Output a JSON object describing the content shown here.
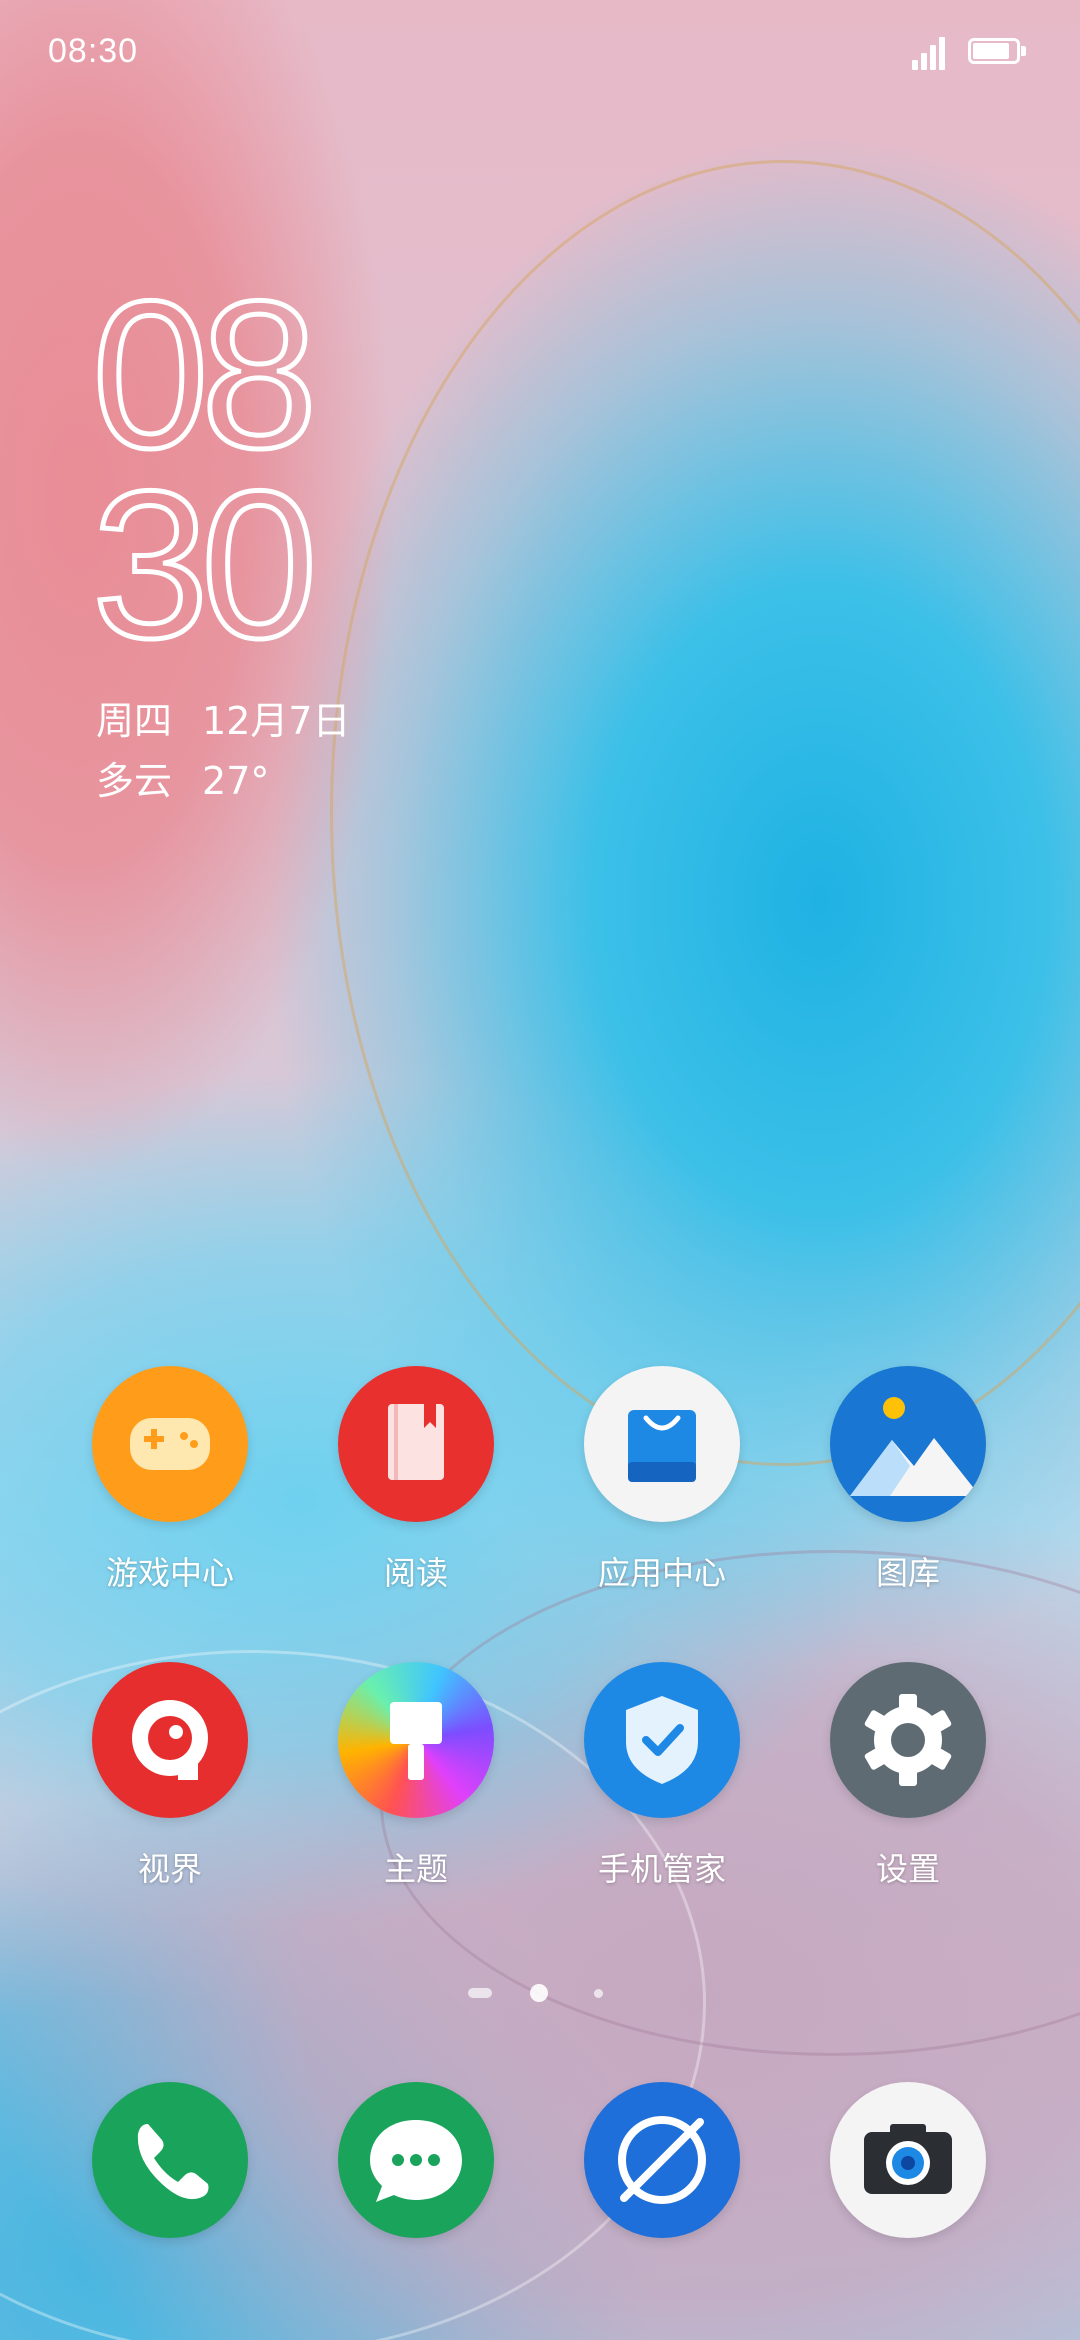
{
  "status_bar": {
    "time": "08:30",
    "battery_level": 0.85,
    "signal_bars": 4
  },
  "clock_widget": {
    "hour": "08",
    "minute": "30",
    "weekday": "周四",
    "date": "12月7日",
    "weather": "多云",
    "temperature": "27°"
  },
  "apps": [
    {
      "label": "游戏中心",
      "icon": "gamepad-icon",
      "color": "#ff9c1a"
    },
    {
      "label": "阅读",
      "icon": "book-icon",
      "color": "#e8312f"
    },
    {
      "label": "应用中心",
      "icon": "shopping-bag-icon",
      "color": "#1e88e5"
    },
    {
      "label": "图库",
      "icon": "gallery-icon",
      "color": "#1976d2"
    },
    {
      "label": "视界",
      "icon": "video-eye-icon",
      "color": "#e62e2e"
    },
    {
      "label": "主题",
      "icon": "paintbrush-icon",
      "color": "#e040fb"
    },
    {
      "label": "手机管家",
      "icon": "shield-check-icon",
      "color": "#1e88e5"
    },
    {
      "label": "设置",
      "icon": "gear-icon",
      "color": "#5f6b73"
    }
  ],
  "dock": [
    {
      "icon": "phone-icon",
      "color": "#1aa35a"
    },
    {
      "icon": "message-icon",
      "color": "#1aa35a"
    },
    {
      "icon": "browser-compass-icon",
      "color": "#1e6fd9"
    },
    {
      "icon": "camera-icon",
      "color": "#f4f4f4"
    }
  ],
  "page_indicator": {
    "pages": 3,
    "current": 2
  }
}
